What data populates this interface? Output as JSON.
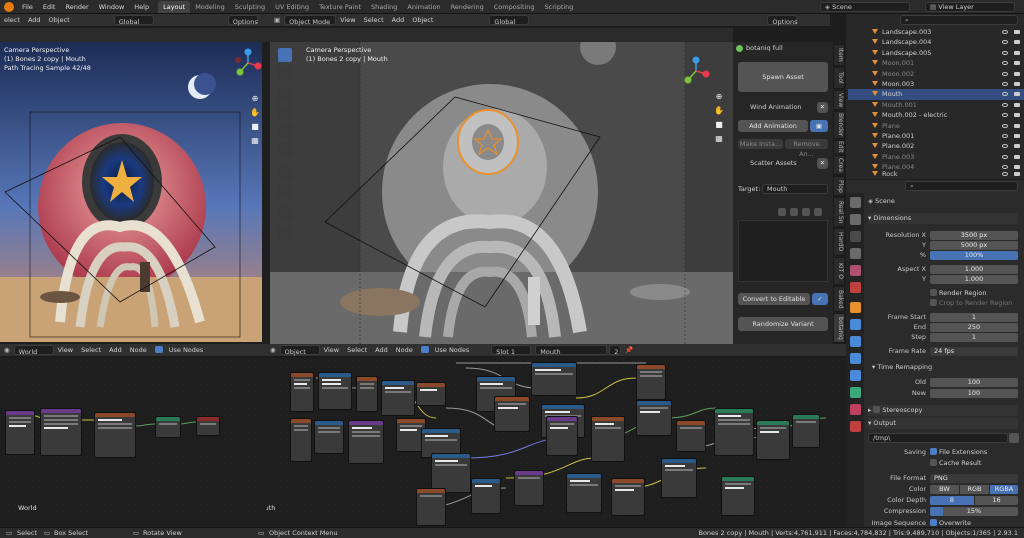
{
  "topbar": {
    "menus": [
      "File",
      "Edit",
      "Render",
      "Window",
      "Help"
    ],
    "workspaces": [
      "Layout",
      "Modeling",
      "Sculpting",
      "UV Editing",
      "Texture Paint",
      "Shading",
      "Animation",
      "Rendering",
      "Compositing",
      "Scripting"
    ],
    "active_workspace": "Layout",
    "scene_label": "Scene",
    "view_layer_label": "View Layer"
  },
  "left_viewport": {
    "header": {
      "select": "elect",
      "add": "Add",
      "object": "Object",
      "orientation": "Global",
      "options": "Options"
    },
    "overlay_lines": [
      "Camera Perspective",
      "(1) Bones 2 copy | Mouth",
      "Path Tracing Sample 42/48"
    ]
  },
  "center_viewport": {
    "header": {
      "mode": "Object Mode",
      "view": "View",
      "select": "Select",
      "add": "Add",
      "object": "Object",
      "orientation": "Global",
      "options": "Options"
    },
    "overlay_lines": [
      "Camera Perspective",
      "(1) Bones 2 copy | Mouth"
    ]
  },
  "botaniq": {
    "title": "botaniq full",
    "spawn_asset": "Spawn Asset",
    "wind_animation": "Wind Animation",
    "add_animation": "Add Animation",
    "make_instance": "Make Insta...",
    "remove_anim": "Remove An...",
    "scatter_assets": "Scatter Assets",
    "target_label": "Target:",
    "target_value": "Mouth",
    "convert_to_editable": "Convert to Editable",
    "randomize_variant": "Randomize Variant"
  },
  "vertical_tabs": [
    "Item",
    "Tool",
    "View",
    "Blender",
    "Edit",
    "Crea",
    "Plop",
    "Real Sn",
    "HardO",
    "KIT O",
    "Baked",
    "botaniq"
  ],
  "outliner": {
    "search_placeholder": "",
    "rows": [
      {
        "name": "Landscape.003",
        "dim": false,
        "selected": false
      },
      {
        "name": "Landscape.004",
        "dim": false,
        "selected": false
      },
      {
        "name": "Landscape.005",
        "dim": false,
        "selected": false
      },
      {
        "name": "Moon.001",
        "dim": true,
        "selected": false
      },
      {
        "name": "Moon.002",
        "dim": true,
        "selected": false
      },
      {
        "name": "Moon.003",
        "dim": false,
        "selected": false
      },
      {
        "name": "Mouth",
        "dim": false,
        "selected": true
      },
      {
        "name": "Mouth.001",
        "dim": true,
        "selected": false
      },
      {
        "name": "Mouth.002 - electric",
        "dim": false,
        "selected": false
      },
      {
        "name": "Plane",
        "dim": true,
        "selected": false
      },
      {
        "name": "Plane.001",
        "dim": false,
        "selected": false
      },
      {
        "name": "Plane.002",
        "dim": false,
        "selected": false
      },
      {
        "name": "Plane.003",
        "dim": true,
        "selected": false
      },
      {
        "name": "Plane.004",
        "dim": true,
        "selected": false
      },
      {
        "name": "Rock",
        "dim": false,
        "selected": false
      }
    ]
  },
  "properties": {
    "context": "Scene",
    "dimensions_title": "Dimensions",
    "resolution_x_label": "Resolution X",
    "resolution_x": "3500 px",
    "y_label": "Y",
    "resolution_y": "5000 px",
    "percent_label": "%",
    "percent": "100%",
    "aspect_x_label": "Aspect X",
    "aspect_x": "1.000",
    "aspect_y": "1.000",
    "render_region": "Render Region",
    "crop_region": "Crop to Render Region",
    "frame_start_label": "Frame Start",
    "frame_start": "1",
    "end_label": "End",
    "frame_end": "250",
    "step_label": "Step",
    "frame_step": "1",
    "frame_rate_label": "Frame Rate",
    "frame_rate": "24 fps",
    "time_remapping": "Time Remapping",
    "old_label": "Old",
    "old": "100",
    "new_label": "New",
    "new": "100",
    "stereoscopy": "Stereoscopy",
    "output_title": "Output",
    "output_path": "/tmp\\",
    "saving_label": "Saving",
    "file_extensions": "File Extensions",
    "cache_result": "Cache Result",
    "file_format_label": "File Format",
    "file_format": "PNG",
    "color_label": "Color",
    "color_options": [
      "BW",
      "RGB",
      "RGBA"
    ],
    "color_active": "RGBA",
    "color_depth_label": "Color Depth",
    "color_depth_options": [
      "8",
      "16"
    ],
    "color_depth_active": "8",
    "compression_label": "Compression",
    "compression": "15%",
    "image_sequence_label": "Image Sequence",
    "overwrite": "Overwrite"
  },
  "node_left": {
    "header": {
      "type": "World",
      "view": "View",
      "select": "Select",
      "add": "Add",
      "node": "Node",
      "use_nodes": "Use Nodes"
    },
    "footer": "World"
  },
  "node_right": {
    "header": {
      "type": "Object",
      "view": "View",
      "select": "Select",
      "add": "Add",
      "node": "Node",
      "use_nodes": "Use Nodes",
      "slot": "Slot 1",
      "material": "Mouth",
      "users": "2"
    },
    "footer": "Mouth"
  },
  "statusbar": {
    "select": "Select",
    "box_select": "Box Select",
    "rotate_view": "Rotate View",
    "context_menu": "Object Context Menu",
    "stats": "Bones 2 copy | Mouth | Verts:4,761,911 | Faces:4,784,832 | Tris:9,489,710 | Objects:1/365 | 2.93.1"
  },
  "colors": {
    "accent_blue": "#4772b3",
    "selection_orange": "#e8902e",
    "sky_top": "#1c2c55",
    "sky_bottom": "#d08866"
  }
}
